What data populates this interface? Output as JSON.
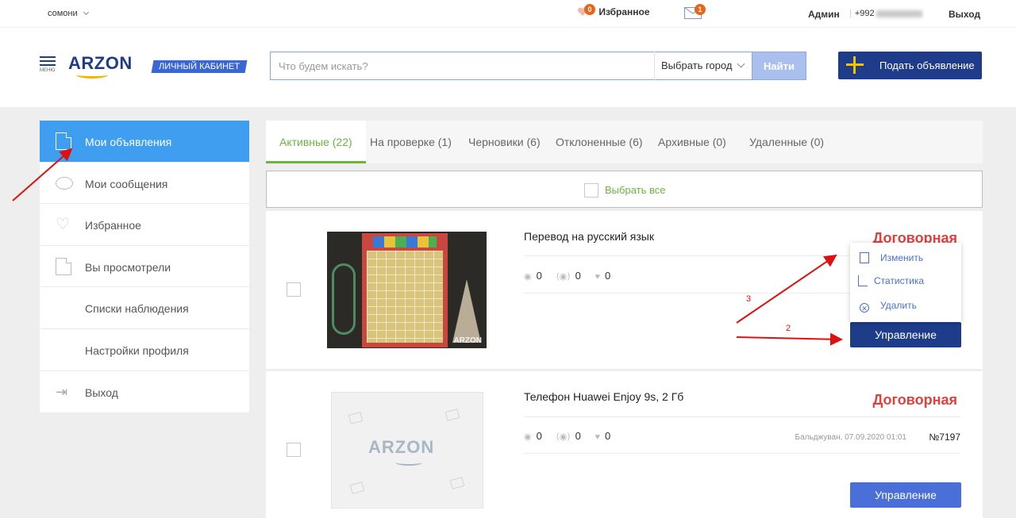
{
  "topbar": {
    "currency": "сомони",
    "favorites_label": "Избранное",
    "favorites_count": "0",
    "messages_count": "1",
    "admin_label": "Админ",
    "phone_prefix": "+992",
    "logout_label": "Выход"
  },
  "header": {
    "menu_label": "МЕНЮ",
    "logo": "ARZON",
    "cabinet_label": "ЛИЧНЫЙ КАБИНЕТ",
    "search_placeholder": "Что будем искать?",
    "city_label": "Выбрать город",
    "find_label": "Найти",
    "post_label": "Подать объявление"
  },
  "sidebar": {
    "items": [
      {
        "label": "Мои объявления",
        "icon": "document-icon",
        "active": true
      },
      {
        "label": "Мои сообщения",
        "icon": "chat-bubble-icon"
      },
      {
        "label": "Избранное",
        "icon": "heart-icon"
      },
      {
        "label": "Вы просмотрели",
        "icon": "document-check-icon"
      },
      {
        "label": "Списки наблюдения"
      },
      {
        "label": "Настройки профиля"
      },
      {
        "label": "Выход",
        "icon": "exit-icon"
      }
    ]
  },
  "tabs": [
    {
      "label": "Активные (22)",
      "active": true
    },
    {
      "label": "На проверке (1)"
    },
    {
      "label": "Черновики (6)"
    },
    {
      "label": "Отклоненные (6)"
    },
    {
      "label": "Архивные (0)"
    },
    {
      "label": "Удаленные (0)"
    }
  ],
  "select_all_label": "Выбрать все",
  "ads": [
    {
      "title": "Перевод на русский язык",
      "price": "Договорная",
      "views": "0",
      "calls": "0",
      "likes": "0",
      "photo_watermark": "ARZON",
      "manage_label": "Управление"
    },
    {
      "title": "Телефон Huawei Enjoy 9s, 2 Гб",
      "price": "Договорная",
      "views": "0",
      "calls": "0",
      "likes": "0",
      "location_date": "Бальджуван,  07.09.2020 01:01",
      "number": "№7197",
      "placeholder_logo": "ARZON",
      "manage_label": "Управление"
    }
  ],
  "dropdown": {
    "edit_label": "Изменить",
    "stats_label": "Статистика",
    "delete_label": "Удалить"
  },
  "annotations": {
    "step2": "2",
    "step3": "3"
  },
  "colors": {
    "brand_blue": "#1e3c8a",
    "active_blue": "#3f9ef0",
    "tab_green": "#6ab63c",
    "price_red": "#e0413e",
    "arrow_red": "#dd1111"
  }
}
